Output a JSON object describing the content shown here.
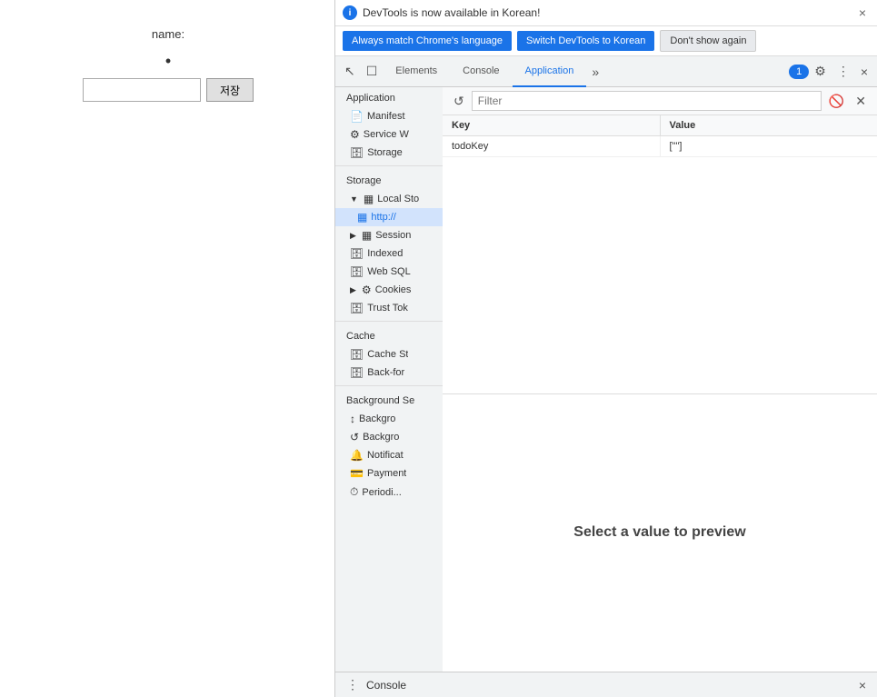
{
  "webpage": {
    "name_label": "name:",
    "name_dot": "•",
    "save_button_label": "저장",
    "input_placeholder": ""
  },
  "devtools": {
    "info_bar": {
      "icon": "i",
      "message": "DevTools is now available in Korean!",
      "close_icon": "×"
    },
    "buttons": {
      "match_language": "Always match Chrome's language",
      "switch_korean": "Switch DevTools to Korean",
      "dont_show": "Don't show again"
    },
    "tabs": {
      "items": [
        {
          "label": "Elements",
          "active": false
        },
        {
          "label": "Console",
          "active": false
        },
        {
          "label": "Application",
          "active": true
        }
      ],
      "more_label": "»",
      "notification_count": "1",
      "settings_icon": "⚙",
      "menu_icon": "⋮",
      "close_icon": "×"
    },
    "toolbar_icons": {
      "cursor_icon": "↖",
      "device_icon": "□"
    },
    "sidebar": {
      "section_application": "Application",
      "items_application": [
        {
          "label": "Manifest",
          "icon": "📄"
        },
        {
          "label": "Service W",
          "icon": "⚙"
        },
        {
          "label": "Storage",
          "icon": "🗄"
        }
      ],
      "section_storage": "Storage",
      "items_storage": [
        {
          "label": "Local Sto",
          "icon": "▦",
          "expanded": true,
          "indent": 0
        },
        {
          "label": "http://",
          "icon": "▦",
          "indent": 1,
          "selected": true
        },
        {
          "label": "Session",
          "icon": "▦",
          "indent": 0,
          "collapsed": true
        },
        {
          "label": "Indexed",
          "icon": "🗄",
          "indent": 0
        },
        {
          "label": "Web SQL",
          "icon": "🗄",
          "indent": 0
        },
        {
          "label": "Cookies",
          "icon": "⚙",
          "indent": 0,
          "collapsed": true
        },
        {
          "label": "Trust Tok",
          "icon": "🗄",
          "indent": 0
        }
      ],
      "section_cache": "Cache",
      "items_cache": [
        {
          "label": "Cache St",
          "icon": "🗄"
        },
        {
          "label": "Back-for",
          "icon": "🗄"
        }
      ],
      "section_background": "Background Se",
      "items_background": [
        {
          "label": "Backgro",
          "icon": "↕"
        },
        {
          "label": "Backgro",
          "icon": "↺"
        },
        {
          "label": "Notificat",
          "icon": "🔔"
        },
        {
          "label": "Payment",
          "icon": "💳"
        },
        {
          "label": "Periodi...",
          "icon": "⏱"
        }
      ]
    },
    "filter": {
      "placeholder": "Filter",
      "refresh_icon": "↺",
      "clear_icon": "🚫"
    },
    "table": {
      "columns": [
        "Key",
        "Value"
      ],
      "rows": [
        {
          "key": "todoKey",
          "value": "[\"\"]"
        }
      ]
    },
    "preview": {
      "text": "Select a value to preview"
    },
    "bottom_bar": {
      "menu_icon": "⋮",
      "console_label": "Console",
      "close_icon": "×"
    }
  }
}
